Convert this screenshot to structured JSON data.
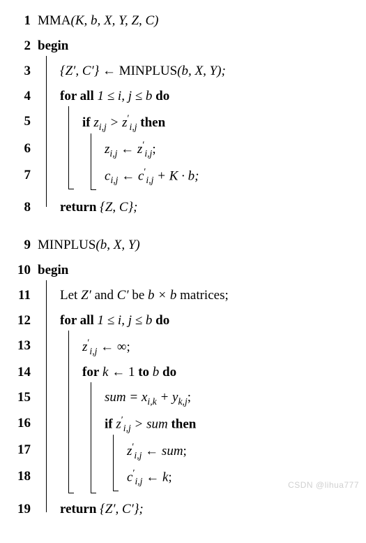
{
  "algo1": {
    "l1": {
      "no": "1",
      "fn": "MMA",
      "args": "(K, b, X, Y, Z, C)"
    },
    "l2": {
      "no": "2",
      "kw": "begin"
    },
    "l3": {
      "no": "3",
      "lhs": "{Z′, C′}",
      "arrow": " ← ",
      "rhs_fn": "MINPLUS",
      "rhs_args": "(b, X, Y);"
    },
    "l4": {
      "no": "4",
      "kw1": "for all",
      "cond": " 1 ≤ i, j ≤ b ",
      "kw2": "do"
    },
    "l5": {
      "no": "5",
      "kw1": "if",
      "a": " z",
      "asub": "i,j",
      "gt": " > ",
      "b": "z",
      "bsup": "′",
      "bsub": "i,j",
      "kw2": " then"
    },
    "l6": {
      "no": "6",
      "a": "z",
      "asub": "i,j",
      "arrow": " ← ",
      "b": "z",
      "bsup": "′",
      "bsub": "i,j",
      "end": ";"
    },
    "l7": {
      "no": "7",
      "a": "c",
      "asub": "i,j",
      "arrow": " ← ",
      "b": "c",
      "bsup": "′",
      "bsub": "i,j",
      "plus": " + K · b;"
    },
    "l8": {
      "no": "8",
      "kw": "return",
      "val": " {Z, C};"
    }
  },
  "algo2": {
    "l9": {
      "no": "9",
      "fn": "MINPLUS",
      "args": "(b, X, Y)"
    },
    "l10": {
      "no": "10",
      "kw": "begin"
    },
    "l11": {
      "no": "11",
      "pre": "Let ",
      "z": "Z′",
      "and": " and ",
      "c": "C′",
      "be": " be ",
      "dim": "b × b",
      "post": " matrices;"
    },
    "l12": {
      "no": "12",
      "kw1": "for all",
      "cond": " 1 ≤ i, j ≤ b ",
      "kw2": "do"
    },
    "l13": {
      "no": "13",
      "a": "z",
      "asup": "′",
      "asub": "i,j",
      "arrow": " ← ∞;"
    },
    "l14": {
      "no": "14",
      "kw1": "for",
      "var": " k ",
      "arrow": "← 1 ",
      "kw2": "to",
      "b": " b ",
      "kw3": "do"
    },
    "l15": {
      "no": "15",
      "lhs": "sum",
      "eq": " = ",
      "x": "x",
      "xsub": "i,k",
      "plus": " + ",
      "y": "y",
      "ysub": "k,j",
      "end": ";"
    },
    "l16": {
      "no": "16",
      "kw1": "if",
      "a": " z",
      "asup": "′",
      "asub": "i,j",
      "gt": " > ",
      "b": "sum",
      "kw2": " then"
    },
    "l17": {
      "no": "17",
      "a": "z",
      "asup": "′",
      "asub": "i,j",
      "arrow": " ← ",
      "b": "sum",
      "end": ";"
    },
    "l18": {
      "no": "18",
      "a": "c",
      "asup": "′",
      "asub": "i,j",
      "arrow": " ← ",
      "b": "k",
      "end": ";"
    },
    "l19": {
      "no": "19",
      "kw": "return",
      "val": " {Z′, C′};"
    }
  },
  "watermark": "CSDN @lihua777"
}
